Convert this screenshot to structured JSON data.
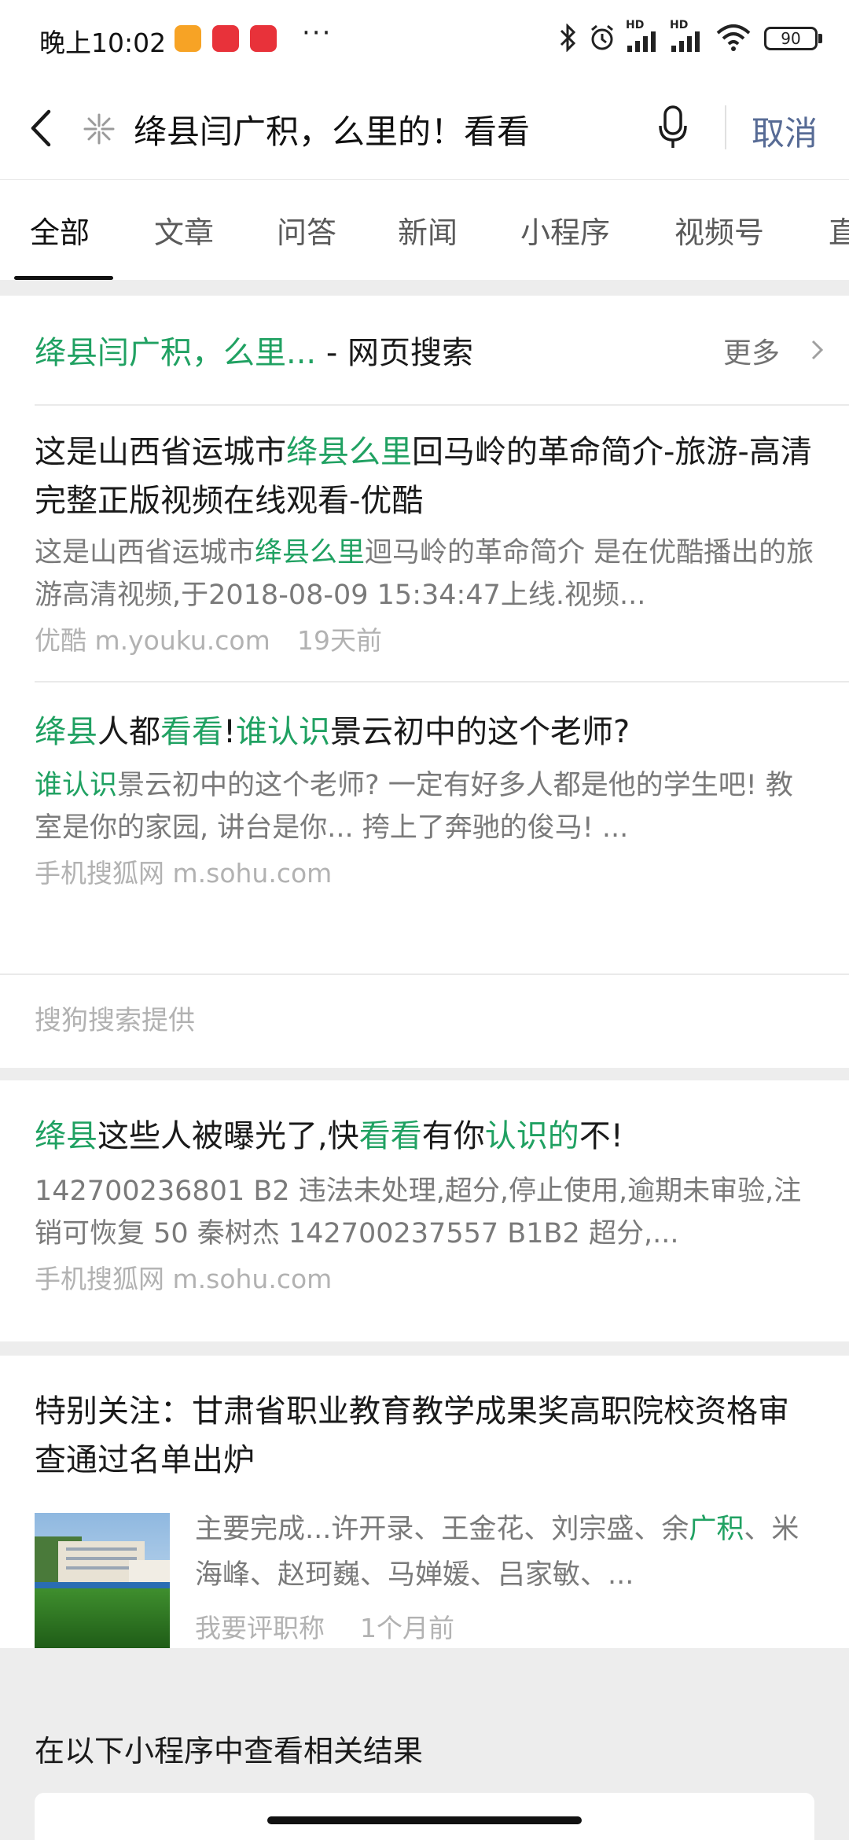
{
  "status_bar": {
    "time": "晚上10:02",
    "more": "···",
    "hd_1": "HD",
    "hd_2": "HD",
    "battery": "90",
    "colors": {
      "app1": "#f7a325",
      "app2": "#e8323a",
      "app3": "#e8323a"
    }
  },
  "search": {
    "query": "绛县闫广积，么里的！看看",
    "cancel_label": "取消"
  },
  "tabs": [
    {
      "label": "全部",
      "active": true
    },
    {
      "label": "文章"
    },
    {
      "label": "问答"
    },
    {
      "label": "新闻"
    },
    {
      "label": "小程序"
    },
    {
      "label": "视频号"
    },
    {
      "label": "直"
    }
  ],
  "web_search": {
    "query": "绛县闫广积，么里...",
    "suffix": " - 网页搜索",
    "more_label": "更多"
  },
  "results": [
    {
      "title": [
        {
          "t": "这是山西省运城市"
        },
        {
          "t": "绛县么里",
          "hl": true
        },
        {
          "t": "回马岭的革命简介-旅游-高清完整正版视频在线观看-优酷"
        }
      ],
      "snippet": [
        {
          "t": "这是山西省运城市"
        },
        {
          "t": "绛县么里",
          "hl": true
        },
        {
          "t": "迴马岭的革命简介 是在优酷播出的旅游高清视频,于2018-08-09 15:34:47上线.视频..."
        }
      ],
      "source": "优酷 m.youku.com",
      "time": "19天前"
    },
    {
      "title": [
        {
          "t": "绛县",
          "hl": true
        },
        {
          "t": "人都"
        },
        {
          "t": "看看",
          "hl": true
        },
        {
          "t": "!"
        },
        {
          "t": "谁认识",
          "hl": true
        },
        {
          "t": "景云初中的这个老师?"
        }
      ],
      "snippet": [
        {
          "t": "谁认识",
          "hl": true
        },
        {
          "t": "景云初中的这个老师? 一定有好多人都是他的学生吧! 教室是你的家园, 讲台是你... 挎上了奔驰的俊马! ..."
        }
      ],
      "source": "手机搜狐网 m.sohu.com"
    },
    {
      "title": [
        {
          "t": "绛县",
          "hl": true
        },
        {
          "t": "这些人被曝光了,快"
        },
        {
          "t": "看看",
          "hl": true
        },
        {
          "t": "有你"
        },
        {
          "t": "认识的",
          "hl": true
        },
        {
          "t": "不!"
        }
      ],
      "snippet": [
        {
          "t": "142700236801 B2 违法未处理,超分,停止使用,逾期未审验,注销可恢复 50 秦树杰 142700237557 B1B2 超分,..."
        }
      ],
      "source": "手机搜狐网 m.sohu.com"
    },
    {
      "title": [
        {
          "t": "特别关注：甘肃省职业教育教学成果奖高职院校资格审查通过名单出炉"
        }
      ],
      "snippet": [
        {
          "t": "主要完成...许开录、王金花、刘宗盛、余"
        },
        {
          "t": "广积",
          "hl": true
        },
        {
          "t": "、米海峰、赵珂巍、马婵媛、吕家敏、..."
        }
      ],
      "source": "我要评职称",
      "time": "1个月前"
    }
  ],
  "provider_note": "搜狗搜索提供",
  "mini_programs_title": "在以下小程序中查看相关结果",
  "colors": {
    "highlight": "#20a162",
    "link_blue": "#576b95",
    "muted": "#b2b2b2"
  }
}
